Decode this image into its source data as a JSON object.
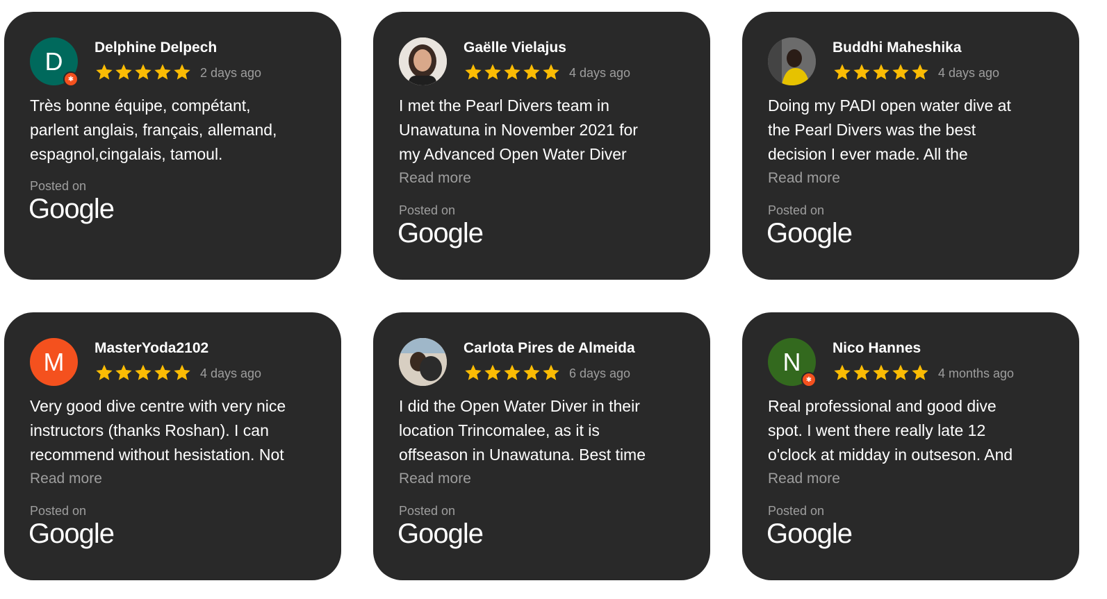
{
  "colors": {
    "card_bg": "#292929",
    "star": "#fbbc04",
    "muted": "#9e9e9e",
    "avatar_d": "#00695c",
    "avatar_m": "#f4511e",
    "avatar_n": "#33691e"
  },
  "common": {
    "posted_on": "Posted on",
    "platform": "Google",
    "read_more": "Read more"
  },
  "reviews": [
    {
      "name": "Delphine Delpech",
      "avatar_letter": "D",
      "rating": 5,
      "time": "2 days ago",
      "lines": [
        "Très bonne équipe, compétant,",
        "parlent anglais, français, allemand,",
        "espagnol,cingalais, tamoul."
      ]
    },
    {
      "name": "Gaëlle Vielajus",
      "avatar_icon": "user-photo",
      "rating": 5,
      "time": "4 days ago",
      "lines": [
        "I met the Pearl Divers team in",
        "Unawatuna in November 2021 for",
        "my Advanced Open Water Diver"
      ]
    },
    {
      "name": "Buddhi Maheshika",
      "avatar_icon": "user-photo",
      "rating": 5,
      "time": "4 days ago",
      "lines": [
        "Doing my PADI open water dive at",
        "the Pearl Divers was the best",
        "decision I ever made. All the"
      ]
    },
    {
      "name": "MasterYoda2102",
      "avatar_letter": "M",
      "rating": 5,
      "time": "4 days ago",
      "lines": [
        "Very good dive centre with very nice",
        "instructors (thanks Roshan). I can",
        "recommend without hesistation. Not"
      ]
    },
    {
      "name": "Carlota Pires de Almeida",
      "avatar_icon": "user-photo",
      "rating": 5,
      "time": "6 days ago",
      "lines": [
        "I did the Open Water Diver in their",
        "location Trincomalee, as it is",
        "offseason in Unawatuna. Best time"
      ]
    },
    {
      "name": "Nico Hannes",
      "avatar_letter": "N",
      "rating": 5,
      "time": "4 months ago",
      "lines": [
        "Real professional and good dive",
        "spot. I went there really late 12",
        "o'clock at midday in outseson. And"
      ]
    }
  ]
}
